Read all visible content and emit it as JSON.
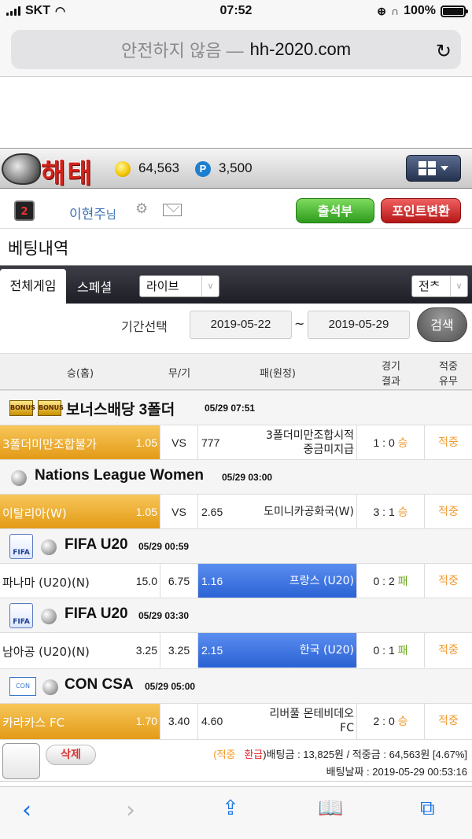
{
  "status": {
    "carrier": "SKT",
    "time": "07:52",
    "battery": "100%"
  },
  "url": {
    "security": "안전하지 않음 —",
    "domain": "hh-2020.com"
  },
  "header": {
    "logo_text": "해태",
    "coins": "64,563",
    "points": "3,500",
    "point_letter": "P"
  },
  "user": {
    "name": "이현주",
    "suffix": "님",
    "badge": "2",
    "attendance_label": "출석부",
    "point_convert_label": "포인트변환"
  },
  "page_title": "베팅내역",
  "tabs": {
    "all_games": "전체게임",
    "special": "스페셜",
    "live_select": "라이브",
    "filter_select": "전ᄎ"
  },
  "date_filter": {
    "label": "기간선택",
    "from": "2019-05-22",
    "tilde": "~",
    "to": "2019-05-29",
    "search_label": "검색"
  },
  "columns": {
    "home": "승(홈)",
    "draw": "무/기",
    "away": "패(원정)",
    "result_1": "경기",
    "result_2": "결과",
    "hit_1": "적중",
    "hit_2": "유무"
  },
  "games": [
    {
      "league": "보너스배당 3폴더",
      "date": "05/29 07:51",
      "icon": "bonus-icon",
      "home": "3폴더미만조합불가",
      "home_odds": "1.05",
      "draw": "VS",
      "away_odds": "777",
      "away_l1": "3폴더미만조합시적",
      "away_l2": "중금미지급",
      "score": "1 : 0",
      "outcome": "승",
      "hit": "적중"
    },
    {
      "league": "Nations League Women",
      "date": "05/29 03:00",
      "icon": "volleyball-icon",
      "home": "이탈리아(W)",
      "home_odds": "1.05",
      "draw": "VS",
      "away_odds": "2.65",
      "away_l1": "도미니카공화국(W)",
      "score": "3 : 1",
      "outcome": "승",
      "hit": "적중"
    },
    {
      "league": "FIFA U20",
      "date": "05/29 00:59",
      "icon": "fifa-icon",
      "home": "파나마 (U20)(N)",
      "home_odds": "15.0",
      "draw": "6.75",
      "away_odds": "1.16",
      "away_l1": "프랑스 (U20)",
      "score": "0 : 2",
      "outcome": "패",
      "hit": "적중"
    },
    {
      "league": "FIFA U20",
      "date": "05/29 03:30",
      "icon": "fifa-icon",
      "home": "남아공 (U20)(N)",
      "home_odds": "3.25",
      "draw": "3.25",
      "away_odds": "2.15",
      "away_l1": "한국 (U20)",
      "score": "0 : 1",
      "outcome": "패",
      "hit": "적중"
    },
    {
      "league": "CON CSA",
      "date": "05/29 05:00",
      "icon": "conmebol-icon",
      "home": "카라카스 FC",
      "home_odds": "1.70",
      "draw": "3.40",
      "away_odds": "4.60",
      "away_l1": "리버풀 몬테비데오",
      "away_l2": "FC",
      "score": "2 : 0",
      "outcome": "승",
      "hit": "적중"
    }
  ],
  "logo_fifa": "FIFA",
  "logo_bonus": "BONUS",
  "logo_con": "CON",
  "footer": {
    "delete_label": "삭제",
    "status_hit": "(적중",
    "status_refund": "환급",
    "bet_text": ")배팅금 : 13,825원 / 적중금 : 64,563원 [4.67%]",
    "date_text": "배팅날짜 : 2019-05-29 00:53:16"
  },
  "colors": {
    "win_home": "#e39a15",
    "win_away": "#2a62d4",
    "hit": "#f29a2e",
    "loss": "#6aa81e"
  }
}
